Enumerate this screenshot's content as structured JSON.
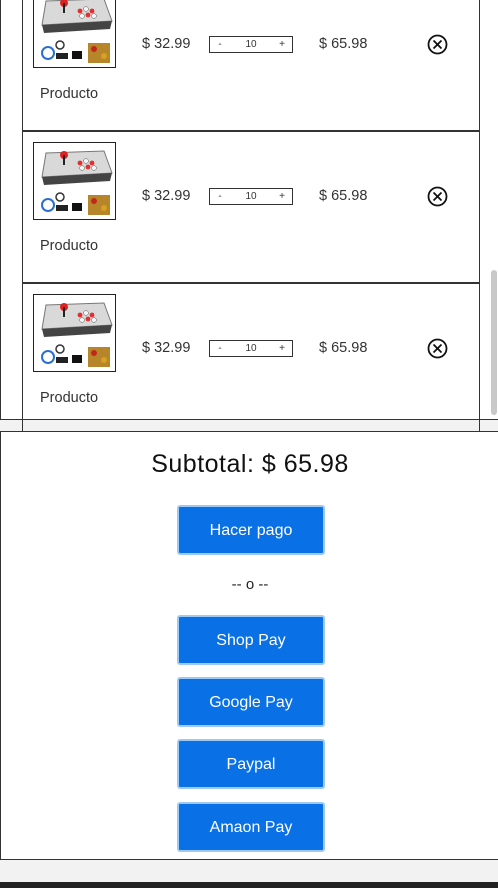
{
  "cart": {
    "items": [
      {
        "name": "Producto",
        "price": "$ 32.99",
        "qty_minus": "-",
        "qty_value": "10",
        "qty_plus": "+",
        "total": "$ 65.98",
        "thumbnail_icon": "arcade-console-image",
        "remove_icon": "remove-circle-x-icon"
      },
      {
        "name": "Producto",
        "price": "$ 32.99",
        "qty_minus": "-",
        "qty_value": "10",
        "qty_plus": "+",
        "total": "$ 65.98",
        "thumbnail_icon": "arcade-console-image",
        "remove_icon": "remove-circle-x-icon"
      },
      {
        "name": "Producto",
        "price": "$ 32.99",
        "qty_minus": "-",
        "qty_value": "10",
        "qty_plus": "+",
        "total": "$ 65.98",
        "thumbnail_icon": "arcade-console-image",
        "remove_icon": "remove-circle-x-icon"
      }
    ]
  },
  "summary": {
    "subtotal": "Subtotal: $ 65.98",
    "checkout_label": "Hacer pago",
    "separator": "-- o --",
    "payment_options": [
      "Shop Pay",
      "Google Pay",
      "Paypal",
      "Amaon Pay"
    ]
  },
  "colors": {
    "button_bg": "#0a70e6",
    "button_border": "#9ec9f5",
    "button_text": "#ffffff",
    "border": "#333333"
  }
}
